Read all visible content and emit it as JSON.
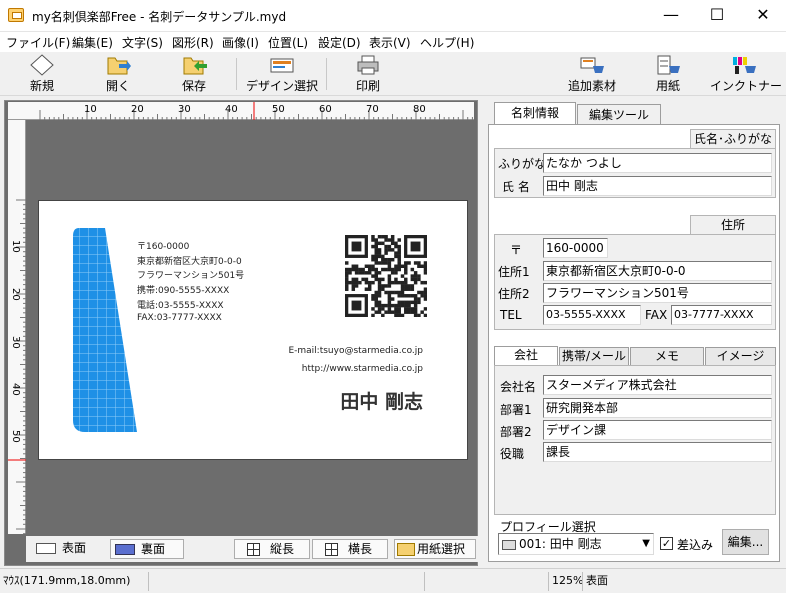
{
  "window": {
    "title": "my名刺倶楽部Free - 名刺データサンプル.myd",
    "minimize": "—",
    "maximize": "☐",
    "close": "✕"
  },
  "menu": [
    "ファイル(F)",
    "編集(E)",
    "文字(S)",
    "図形(R)",
    "画像(I)",
    "位置(L)",
    "設定(D)",
    "表示(V)",
    "ヘルプ(H)"
  ],
  "toolbar": {
    "new": "新規",
    "open": "開く",
    "save": "保存",
    "design": "デザイン選択",
    "print": "印刷",
    "addons": "追加素材",
    "paper": "用紙",
    "ink": "インクトナー"
  },
  "ruler": {
    "h": [
      "10",
      "20",
      "30",
      "40",
      "50",
      "60",
      "70",
      "80"
    ],
    "v": [
      "10",
      "20",
      "30",
      "40",
      "50"
    ]
  },
  "card": {
    "zip": "〒160-0000",
    "addr1": "東京都新宿区大京町0-0-0",
    "addr2": "フラワーマンション501号",
    "mobile": "携帯:090-5555-XXXX",
    "tel": "電話:03-5555-XXXX",
    "fax": "FAX:03-7777-XXXX",
    "email": "E-mail:tsuyo@starmedia.co.jp",
    "url": "http://www.starmedia.co.jp",
    "name": "田中 剛志",
    "accent": "#1e90e6"
  },
  "bottom": {
    "front": "表面",
    "back": "裏面",
    "portrait": "縦長",
    "landscape": "横長",
    "paper_select": "用紙選択"
  },
  "right": {
    "tabs": [
      "名刺情報",
      "編集ツール"
    ],
    "name_section": "氏名･ふりがな",
    "furigana_label": "ふりがな",
    "furigana_value": "たなか つよし",
    "name_label": "氏 名",
    "name_value": "田中 剛志",
    "address_section": "住所",
    "zip_label": "〒",
    "zip_value": "160-0000",
    "addr1_label": "住所1",
    "addr1_value": "東京都新宿区大京町0-0-0",
    "addr2_label": "住所2",
    "addr2_value": "フラワーマンション501号",
    "tel_label": "TEL",
    "tel_value": "03-5555-XXXX",
    "fax_label": "FAX",
    "fax_value": "03-7777-XXXX",
    "sub_tabs": [
      "会社",
      "携帯/メール",
      "メモ",
      "イメージ"
    ],
    "company_label": "会社名",
    "company_value": "スターメディア株式会社",
    "dept1_label": "部署1",
    "dept1_value": "研究開発本部",
    "dept2_label": "部署2",
    "dept2_value": "デザイン課",
    "title_label": "役職",
    "title_value": "課長",
    "profile_label": "プロフィール選択",
    "profile_value": "001: 田中 剛志",
    "insert_label": "差込み",
    "edit_button": "編集..."
  },
  "status": {
    "mouse": "ﾏｳｽ(171.9mm,18.0mm)",
    "zoom": "125%",
    "side": "表面"
  }
}
